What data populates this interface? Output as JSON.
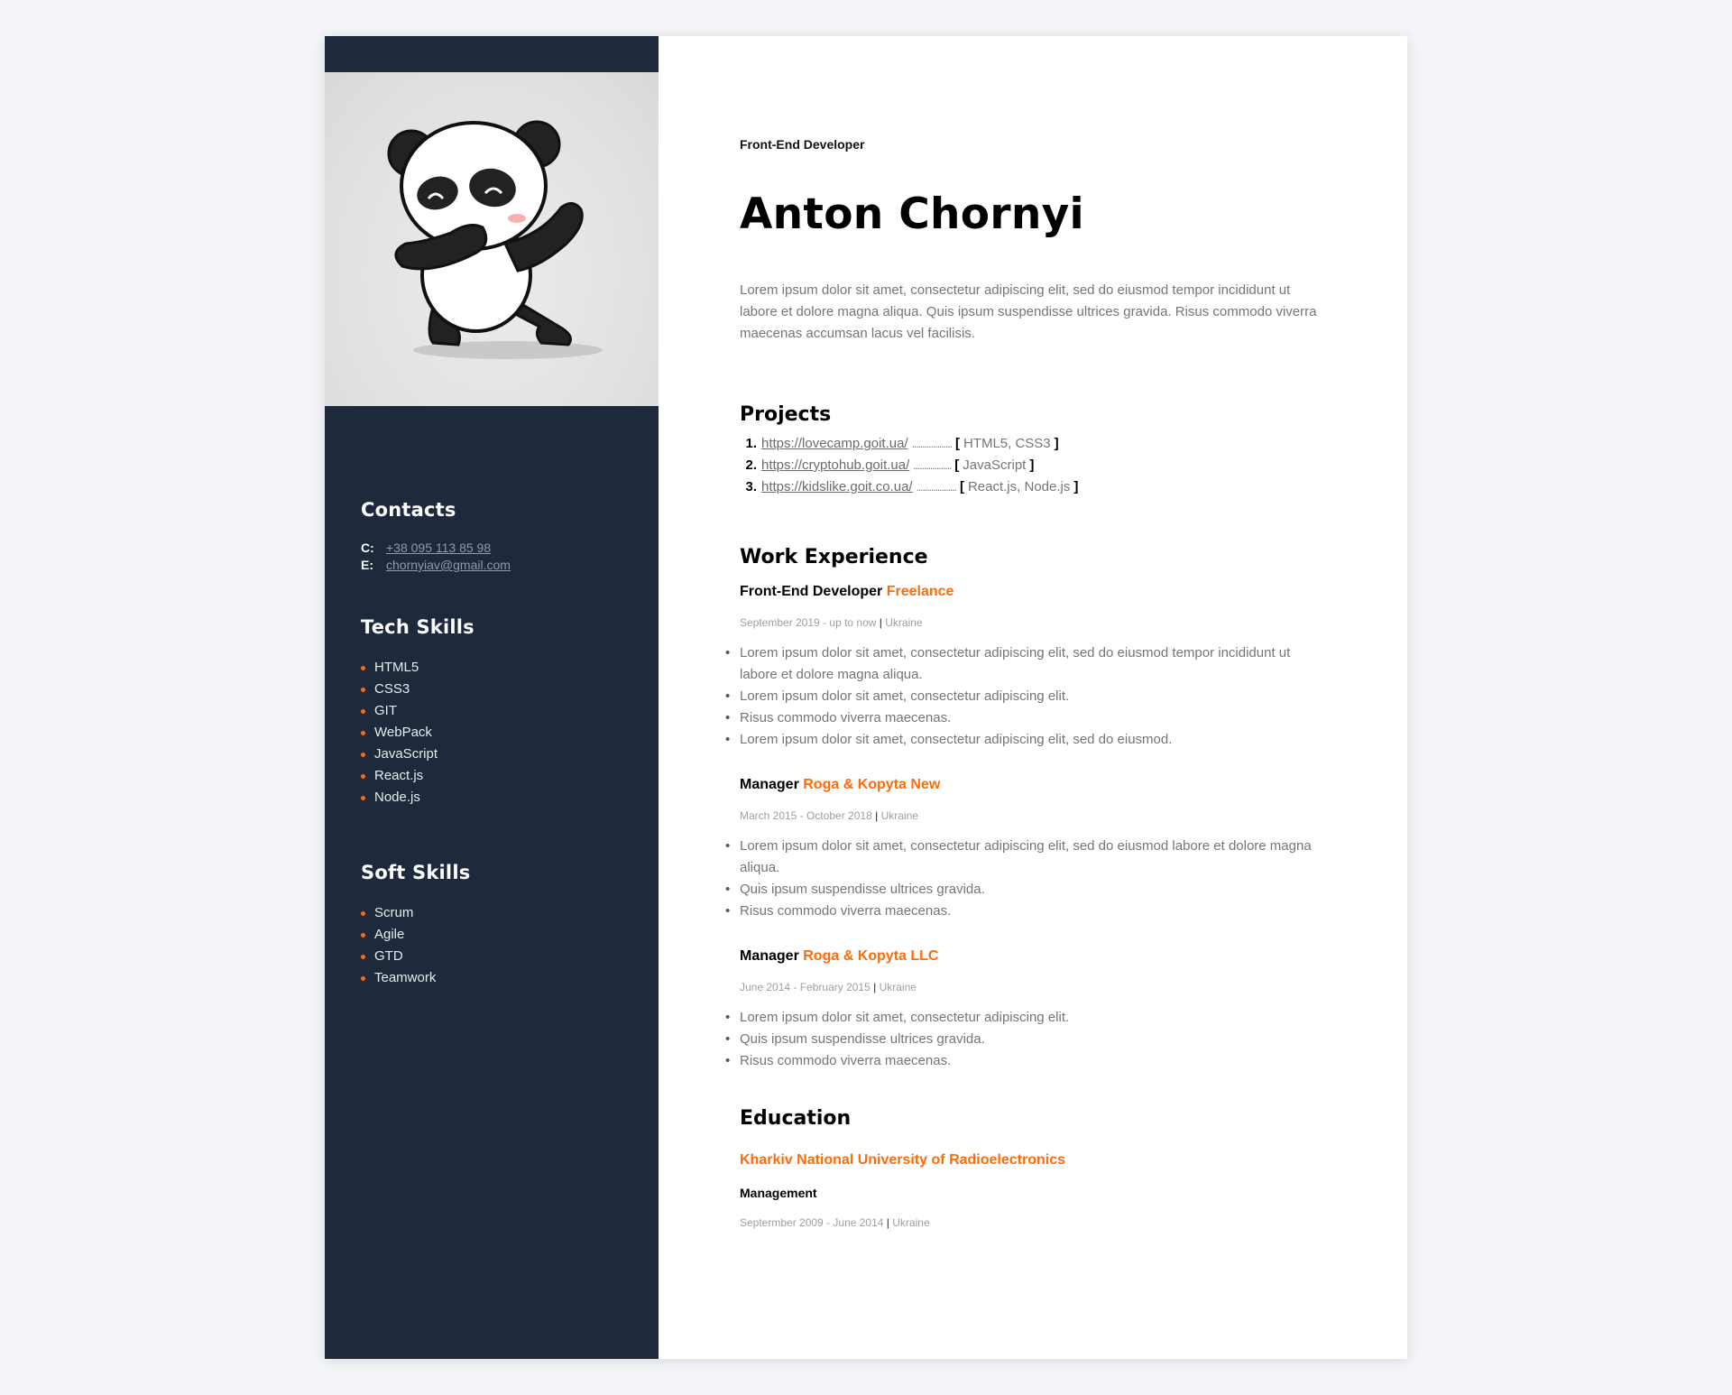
{
  "sidebar": {
    "photo_alt": "dabbing panda",
    "contacts": {
      "title": "Contacts",
      "phone_key": "C:",
      "phone": "+38 095 113 85 98",
      "email_key": "E:",
      "email": "chornyiav@gmail.com"
    },
    "tech_skills": {
      "title": "Tech Skills",
      "items": [
        "HTML5",
        "CSS3",
        "GIT",
        "WebPack",
        "JavaScript",
        "React.js",
        "Node.js"
      ]
    },
    "soft_skills": {
      "title": "Soft Skills",
      "items": [
        "Scrum",
        "Agile",
        "GTD",
        "Teamwork"
      ]
    }
  },
  "main": {
    "role": "Front-End Developer",
    "name": "Anton Chornyi",
    "about": "Lorem ipsum dolor sit amet, consectetur adipiscing elit, sed do eiusmod tempor incididunt ut labore et dolore magna aliqua. Quis ipsum suspendisse ultrices gravida. Risus commodo viverra maecenas accumsan lacus vel facilisis.",
    "projects": {
      "title": "Projects",
      "items": [
        {
          "num": "1.",
          "url": "https://lovecamp.goit.ua/",
          "dots": "...................",
          "open": "[",
          "tech": "HTML5, CSS3",
          "close": "]"
        },
        {
          "num": "2.",
          "url": "https://cryptohub.goit.ua/",
          "dots": "..................",
          "open": "[",
          "tech": "JavaScript",
          "close": "]"
        },
        {
          "num": "3.",
          "url": "https://kidslike.goit.co.ua/",
          "dots": "...................",
          "open": "[",
          "tech": "React.js, Node.js",
          "close": "]"
        }
      ]
    },
    "work": {
      "title": "Work Experience",
      "jobs": [
        {
          "position": "Front-End Developer",
          "company": "Freelance",
          "dates": "September 2019 - up to now",
          "sep": "|",
          "location": "Ukraine",
          "bullets": [
            "Lorem ipsum dolor sit amet, consectetur adipiscing elit, sed do eiusmod tempor incididunt ut labore et dolore magna aliqua.",
            "Lorem ipsum dolor sit amet, consectetur adipiscing elit.",
            "Risus commodo viverra maecenas.",
            "Lorem ipsum dolor sit amet, consectetur adipiscing elit, sed do eiusmod."
          ]
        },
        {
          "position": "Manager",
          "company": "Roga & Kopyta New",
          "dates": "March 2015 - October 2018",
          "sep": "|",
          "location": "Ukraine",
          "bullets": [
            "Lorem ipsum dolor sit amet, consectetur adipiscing elit, sed do eiusmod labore et dolore magna aliqua.",
            "Quis ipsum suspendisse ultrices gravida.",
            "Risus commodo viverra maecenas."
          ]
        },
        {
          "position": "Manager",
          "company": "Roga & Kopyta LLC",
          "dates": "June 2014 - February 2015",
          "sep": "|",
          "location": "Ukraine",
          "bullets": [
            "Lorem ipsum dolor sit amet, consectetur adipiscing elit.",
            "Quis ipsum suspendisse ultrices gravida.",
            "Risus commodo viverra maecenas."
          ]
        }
      ]
    },
    "education": {
      "title": "Education",
      "school": "Kharkiv National University of Radioelectronics",
      "degree": "Management",
      "dates": "Septermber 2009 - June 2014",
      "sep": "|",
      "location": "Ukraine"
    }
  },
  "colors": {
    "sidebar_bg": "#1e293b",
    "accent": "#ff6b08",
    "page_bg": "#f4f5f9"
  }
}
